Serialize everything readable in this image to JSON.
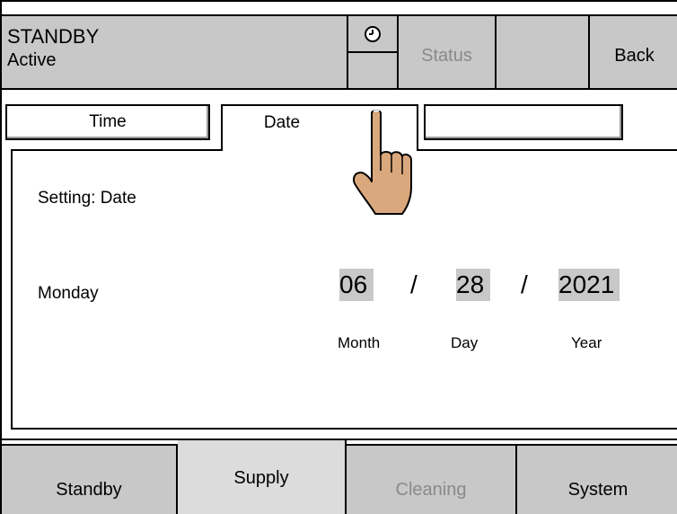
{
  "header": {
    "mode_title": "STANDBY",
    "mode_state": "Active",
    "clock_icon": "clock-icon",
    "status_label": "Status",
    "back_label": "Back"
  },
  "tabs": [
    {
      "label": "Time"
    },
    {
      "label": "Date",
      "active": true
    },
    {
      "label": ""
    }
  ],
  "content": {
    "setting_label": "Setting: Date",
    "weekday": "Monday",
    "month": "06",
    "day": "28",
    "year": "2021",
    "separator": "/",
    "month_label": "Month",
    "day_label": "Day",
    "year_label": "Year"
  },
  "nav": {
    "standby": "Standby",
    "supply": "Supply",
    "cleaning": "Cleaning",
    "system": "System"
  },
  "colors": {
    "panel_gray": "#c8c8c8",
    "disabled_text": "#8a8a8a",
    "hand_skin": "#d9a87c"
  }
}
